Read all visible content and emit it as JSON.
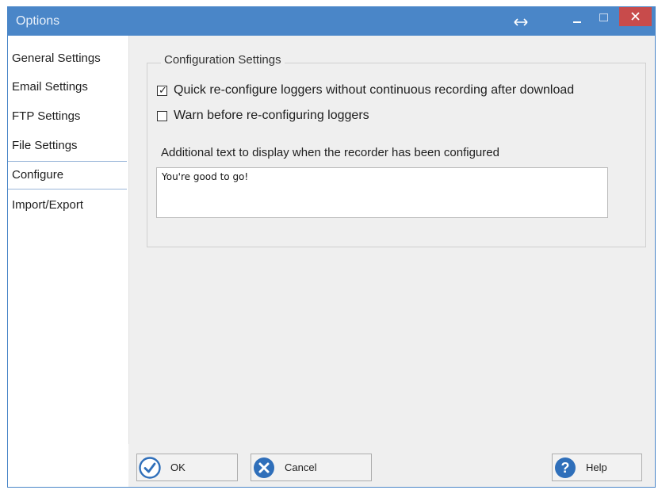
{
  "window": {
    "title": "Options",
    "resize_symbol": "↔"
  },
  "sidebar": {
    "items": [
      {
        "label": "General Settings"
      },
      {
        "label": "Email Settings"
      },
      {
        "label": "FTP Settings"
      },
      {
        "label": "File Settings"
      },
      {
        "label": "Configure",
        "selected": true
      },
      {
        "label": "Import/Export"
      }
    ]
  },
  "config": {
    "group_label": "Configuration Settings",
    "checkboxes": [
      {
        "label": "Quick re-configure loggers without continuous recording after download",
        "checked": true
      },
      {
        "label": "Warn before re-configuring loggers",
        "checked": false
      }
    ],
    "text_label": "Additional text to display when the recorder has been configured",
    "text_value": "You're good to go!"
  },
  "footer": {
    "ok_label": "OK",
    "cancel_label": "Cancel",
    "help_label": "Help"
  },
  "colors": {
    "titlebar": "#4a86c8",
    "close": "#c84b4b",
    "button_icon": "#2f6fba"
  },
  "icons": {
    "ok": "check-circle-icon",
    "cancel": "x-circle-icon",
    "help": "question-circle-icon"
  }
}
